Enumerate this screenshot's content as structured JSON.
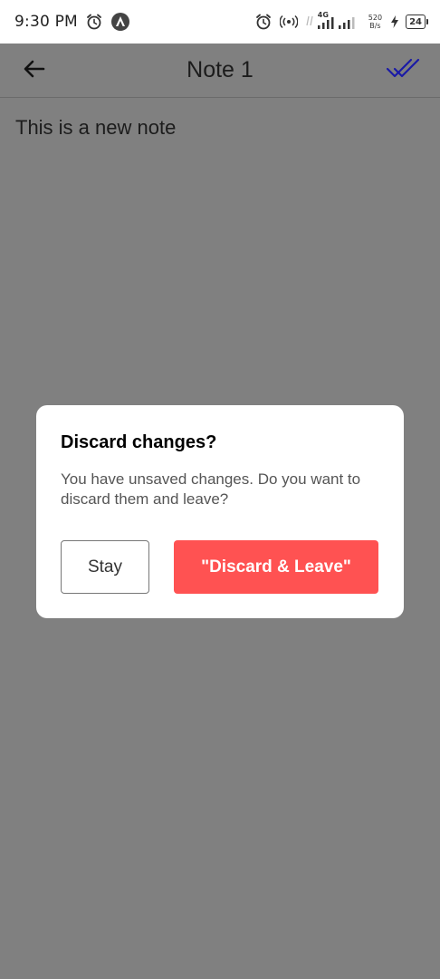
{
  "status_bar": {
    "time": "9:30 PM",
    "network_type": "4G",
    "net_speed_value": "520",
    "net_speed_unit": "B/s",
    "battery_level": "24",
    "icons": [
      "alarm-icon",
      "app-notification-icon",
      "alarm-icon",
      "hotspot-icon",
      "signal-icon",
      "battery-icon"
    ]
  },
  "app_bar": {
    "title": "Note 1",
    "back_icon": "arrow-left-icon",
    "save_icon": "double-check-icon",
    "save_icon_color": "#1a1aa6"
  },
  "note": {
    "content": "This is a new note"
  },
  "dialog": {
    "title": "Discard changes?",
    "message": "You have unsaved changes. Do you want to discard them and leave?",
    "stay_label": "Stay",
    "discard_label": "\"Discard & Leave\"",
    "discard_color": "#ff5252"
  },
  "colors": {
    "scrim": "#808080",
    "status_bar_bg": "#ffffff"
  }
}
